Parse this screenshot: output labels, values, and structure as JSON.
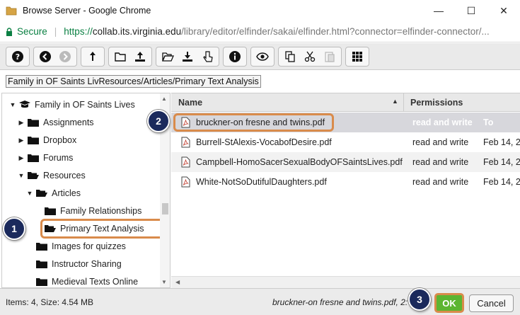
{
  "window": {
    "title": "Browse Server - Google Chrome",
    "controls": {
      "minimize": "—",
      "maximize": "☐",
      "close": "✕"
    }
  },
  "address": {
    "secure_label": "Secure",
    "separator": "|",
    "url_scheme": "https://",
    "url_host": "collab.its.virginia.edu",
    "url_rest": "/library/editor/elfinder/sakai/elfinder.html?connector=elfinder-connector/..."
  },
  "toolbar": {
    "groups": [
      [
        "help-icon"
      ],
      [
        "back-icon",
        "forward-icon"
      ],
      [
        "up-icon"
      ],
      [
        "new-folder-icon",
        "upload-icon"
      ],
      [
        "open-icon",
        "download-icon",
        "select-icon"
      ],
      [
        "info-icon"
      ],
      [
        "preview-icon"
      ],
      [
        "copy-icon",
        "cut-icon",
        "paste-icon"
      ],
      [
        "view-icon"
      ]
    ]
  },
  "path": {
    "value": "Family in OF Saints LivResources/Articles/Primary Text Analysis"
  },
  "tree": {
    "items": [
      {
        "label": "Family in OF Saints Lives",
        "level": 0,
        "arrow": "▼",
        "icon": "root-folder-icon"
      },
      {
        "label": "Assignments",
        "level": 1,
        "arrow": "▶",
        "icon": "folder-icon"
      },
      {
        "label": "Dropbox",
        "level": 1,
        "arrow": "▶",
        "icon": "folder-icon"
      },
      {
        "label": "Forums",
        "level": 1,
        "arrow": "▶",
        "icon": "folder-icon"
      },
      {
        "label": "Resources",
        "level": 1,
        "arrow": "▼",
        "icon": "folder-open-icon"
      },
      {
        "label": "Articles",
        "level": 2,
        "arrow": "▼",
        "icon": "folder-open-icon"
      },
      {
        "label": "Family Relationships",
        "level": 3,
        "arrow": "",
        "icon": "folder-icon"
      },
      {
        "label": "Primary Text Analysis",
        "level": 3,
        "arrow": "",
        "icon": "folder-open-icon",
        "selected": true
      },
      {
        "label": "Images for quizzes",
        "level": 2,
        "arrow": "",
        "icon": "folder-icon"
      },
      {
        "label": "Instructor Sharing",
        "level": 2,
        "arrow": "",
        "icon": "folder-icon"
      },
      {
        "label": "Medieval Texts Online",
        "level": 2,
        "arrow": "",
        "icon": "folder-icon"
      }
    ]
  },
  "files": {
    "headers": {
      "name": "Name",
      "sort": "▲",
      "permissions": "Permissions"
    },
    "rows": [
      {
        "name": "bruckner-on fresne and twins.pdf",
        "permissions": "read and write",
        "date": "To",
        "selected": true
      },
      {
        "name": "Burrell-StAlexis-VocabofDesire.pdf",
        "permissions": "read and write",
        "date": "Feb 14, 2"
      },
      {
        "name": "Campbell-HomoSacerSexualBodyOFSaintsLives.pdf",
        "permissions": "read and write",
        "date": "Feb 14, 2"
      },
      {
        "name": "White-NotSoDutifulDaughters.pdf",
        "permissions": "read and write",
        "date": "Feb 14, 2"
      }
    ]
  },
  "status": {
    "left": "Items: 4, Size: 4.54 MB",
    "right": "bruckner-on fresne and twins.pdf, 2:"
  },
  "buttons": {
    "ok": "OK",
    "cancel": "Cancel"
  },
  "badges": [
    "1",
    "2",
    "3"
  ],
  "colors": {
    "highlight": "#d98b4b",
    "ok_green": "#5cb531",
    "badge": "#1b2a5c",
    "secure_green": "#0b8043"
  }
}
